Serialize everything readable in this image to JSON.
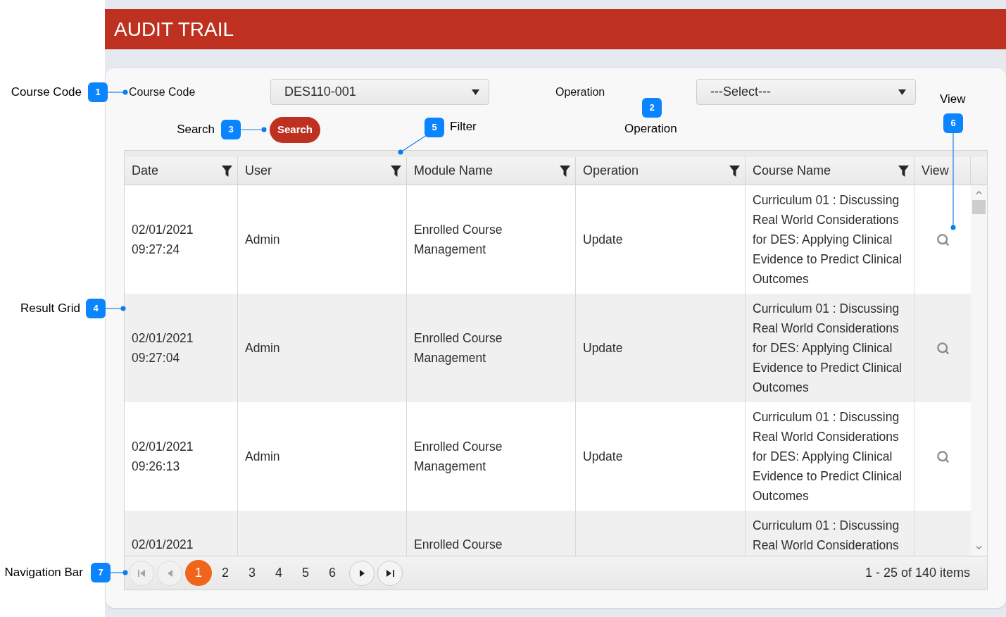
{
  "title_bar": {
    "title": "AUDIT TRAIL"
  },
  "filters": {
    "course_code": {
      "label": "Course Code",
      "value": "DES110-001"
    },
    "operation": {
      "label": "Operation",
      "value": "---Select---"
    },
    "search_button": "Search"
  },
  "grid": {
    "columns": [
      {
        "label": "Date",
        "filterable": true
      },
      {
        "label": "User",
        "filterable": true
      },
      {
        "label": "Module Name",
        "filterable": true
      },
      {
        "label": "Operation",
        "filterable": true
      },
      {
        "label": "Course Name",
        "filterable": true
      },
      {
        "label": "View",
        "filterable": false
      }
    ],
    "rows": [
      {
        "kind": "full",
        "date": "02/01/2021 09:27:24",
        "user": "Admin",
        "module_name": "Enrolled Course Management",
        "operation": "Update",
        "course_name": "Curriculum 01 : Discussing Real World Considerations for DES: Applying Clinical Evidence to Predict Clinical Outcomes"
      },
      {
        "kind": "full",
        "date": "02/01/2021 09:27:04",
        "user": "Admin",
        "module_name": "Enrolled Course Management",
        "operation": "Update",
        "course_name": "Curriculum 01 : Discussing Real World Considerations for DES: Applying Clinical Evidence to Predict Clinical Outcomes"
      },
      {
        "kind": "full",
        "date": "02/01/2021 09:26:13",
        "user": "Admin",
        "module_name": "Enrolled Course Management",
        "operation": "Update",
        "course_name": "Curriculum 01 : Discussing Real World Considerations for DES: Applying Clinical Evidence to Predict Clinical Outcomes"
      },
      {
        "kind": "partial",
        "date": "02/01/2021",
        "module_name": "Enrolled Course",
        "course_name": "Curriculum 01 : Discussing Real World Considerations"
      }
    ]
  },
  "pager": {
    "back_buttons": [
      {
        "kind": "first",
        "disabled": true
      },
      {
        "kind": "previous",
        "disabled": true
      }
    ],
    "pages": [
      {
        "label": "1",
        "selected": true
      },
      {
        "label": "2",
        "selected": false
      },
      {
        "label": "3",
        "selected": false
      },
      {
        "label": "4",
        "selected": false
      },
      {
        "label": "5",
        "selected": false
      },
      {
        "label": "6",
        "selected": false
      }
    ],
    "forward_buttons": [
      {
        "kind": "next",
        "disabled": false
      },
      {
        "kind": "last",
        "disabled": false
      }
    ],
    "summary": "1 - 25 of 140 items"
  },
  "callouts": [
    {
      "number": "1",
      "label": "Course Code"
    },
    {
      "number": "3",
      "label": "Search"
    },
    {
      "number": "5",
      "label": "Filter"
    },
    {
      "number": "2",
      "label": "Operation"
    },
    {
      "number": "6",
      "label": "View"
    },
    {
      "number": "4",
      "label": "Result Grid"
    },
    {
      "number": "7",
      "label": "Navigation Bar"
    }
  ]
}
